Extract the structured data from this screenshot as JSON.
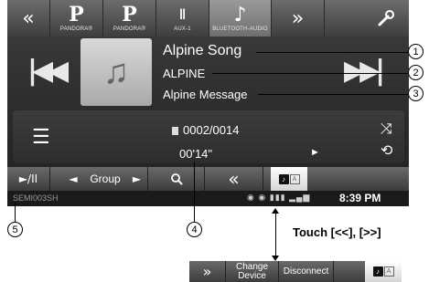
{
  "source_bar": {
    "left_arrow": "«",
    "right_arrow": "»",
    "items": [
      {
        "glyph": "P",
        "label": "PANDORA®"
      },
      {
        "glyph": "P",
        "label": "PANDORA®"
      },
      {
        "glyph": "ǁ",
        "label": "AUX-1"
      },
      {
        "glyph": "♪",
        "label": "BLUETOOTH-AUDIO"
      }
    ],
    "settings_icon": "wrench-icon"
  },
  "player": {
    "title": "Alpine Song",
    "artist": "ALPINE",
    "album": "Alpine Message",
    "track": "0002/0014",
    "time": "00'14\""
  },
  "controls": {
    "play_pause": "►/II",
    "prev_group": "◄",
    "group_label": "Group",
    "next_group": "►",
    "search": "🔍",
    "rewind": "«"
  },
  "status": {
    "device_name": "SEMI003SH",
    "clock": "8:39 PM"
  },
  "callouts": [
    "1",
    "2",
    "3",
    "4",
    "5"
  ],
  "touch_note": "Touch [<<], [>>]",
  "alt_bar": {
    "forward": "»",
    "change_device": "Change Device",
    "disconnect": "Disconnect"
  }
}
